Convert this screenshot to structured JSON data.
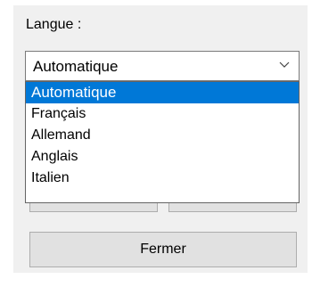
{
  "language_label": "Langue :",
  "language_combo": {
    "selected": "Automatique",
    "options": [
      "Automatique",
      "Français",
      "Allemand",
      "Anglais",
      "Italien"
    ]
  },
  "close_button": "Fermer",
  "colors": {
    "selection": "#0078d7",
    "dialog_background": "#f0f0f0",
    "button_background": "#e1e1e1"
  },
  "icons": {
    "dropdown": "chevron-down-icon"
  }
}
